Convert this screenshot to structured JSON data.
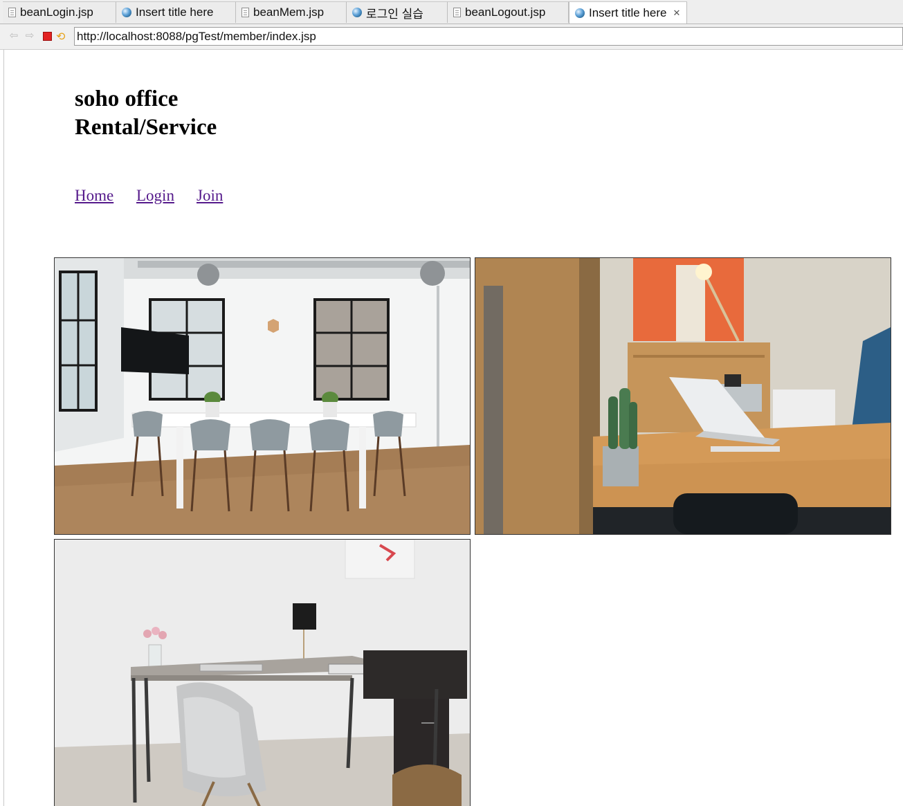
{
  "tabs": [
    {
      "label": "beanLogin.jsp",
      "icon": "file-icon"
    },
    {
      "label": "Insert title here",
      "icon": "globe-icon"
    },
    {
      "label": "beanMem.jsp",
      "icon": "file-icon"
    },
    {
      "label": "로그인 실습",
      "icon": "globe-icon"
    },
    {
      "label": "beanLogout.jsp",
      "icon": "file-icon"
    },
    {
      "label": "Insert title here",
      "icon": "globe-icon",
      "active": true
    }
  ],
  "toolbar": {
    "back_icon": "back-arrow-icon",
    "forward_icon": "forward-arrow-icon",
    "stop_icon": "stop-icon",
    "refresh_icon": "refresh-icon"
  },
  "address": {
    "url": "http://localhost:8088/pgTest/member/index.jsp"
  },
  "page": {
    "brand_line1": "soho office",
    "brand_line2": "Rental/Service",
    "nav": [
      {
        "label": "Home"
      },
      {
        "label": "Login"
      },
      {
        "label": "Join"
      }
    ],
    "link_color": "#551a8b"
  },
  "gallery": [
    {
      "subject": "white meeting room with table and grey chairs"
    },
    {
      "subject": "wooden desk with laptop and cactus"
    },
    {
      "subject": "L-shaped desk with grey armchair"
    }
  ]
}
